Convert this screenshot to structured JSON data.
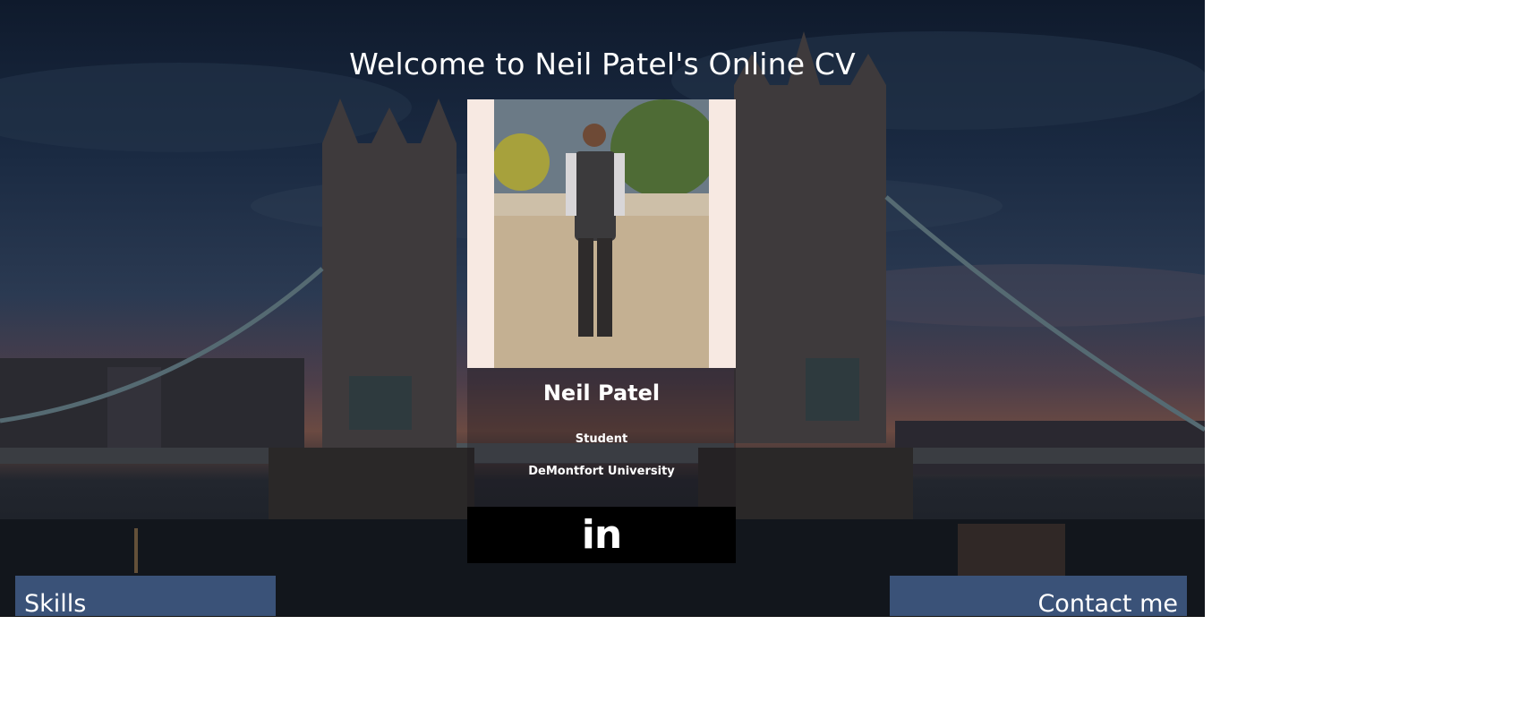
{
  "page": {
    "welcome_title": "Welcome to Neil Patel's Online CV"
  },
  "profile": {
    "photo_alt": "Portrait photo",
    "name": "Neil Patel",
    "role": "Student",
    "university": "DeMontfort University",
    "linkedin_icon": "in"
  },
  "nav": {
    "skills_label": "Skills",
    "contact_label": "Contact me"
  },
  "colors": {
    "nav_button": "#3a5278",
    "linkedin_bar": "#000000",
    "text": "#ffffff"
  }
}
